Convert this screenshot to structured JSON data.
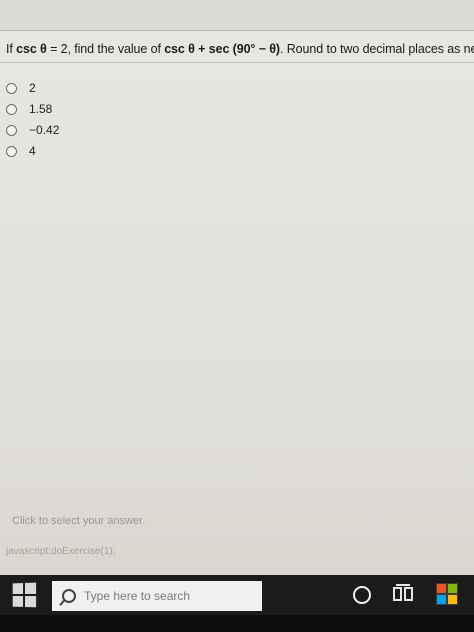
{
  "question": {
    "pre": "If ",
    "expr1": "csc θ",
    "mid": " = 2, find the value of ",
    "expr2": "csc θ + sec (90° − θ)",
    "post": ". Round to two decimal places as neede"
  },
  "options": [
    {
      "label": "2"
    },
    {
      "label": "1.58"
    },
    {
      "label": "−0.42"
    },
    {
      "label": "4"
    }
  ],
  "hint": "Click to select your answer.",
  "status": "javascript:doExercise(1);",
  "taskbar": {
    "search_placeholder": "Type here to search",
    "icons": [
      "windows-start-icon",
      "search-icon",
      "cortana-icon",
      "task-view-icon",
      "store-icon"
    ]
  }
}
